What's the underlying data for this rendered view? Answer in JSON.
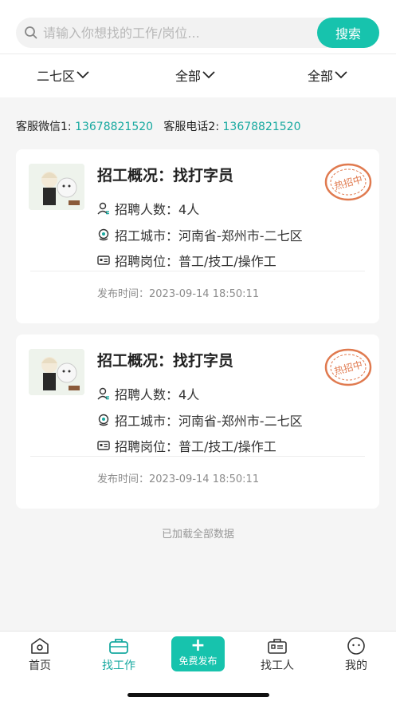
{
  "search": {
    "placeholder": "请输入你想找的工作/岗位...",
    "button_label": "搜索"
  },
  "filters": [
    {
      "label": "二七区"
    },
    {
      "label": "全部"
    },
    {
      "label": "全部"
    }
  ],
  "contact": {
    "wechat_label": "客服微信1:",
    "wechat_number": "13678821520",
    "phone_label": "客服电话2:",
    "phone_number": "13678821520"
  },
  "jobs": [
    {
      "title_prefix": "招工概况：",
      "title": "找打字员",
      "count_label": "招聘人数：",
      "count": "4人",
      "city_label": "招工城市：",
      "city": "河南省-郑州市-二七区",
      "position_label": "招聘岗位：",
      "position": "普工/技工/操作工",
      "time_label": "发布时间：",
      "time": "2023-09-14 18:50:11",
      "stamp": "热招中"
    },
    {
      "title_prefix": "招工概况：",
      "title": "找打字员",
      "count_label": "招聘人数：",
      "count": "4人",
      "city_label": "招工城市：",
      "city": "河南省-郑州市-二七区",
      "position_label": "招聘岗位：",
      "position": "普工/技工/操作工",
      "time_label": "发布时间：",
      "time": "2023-09-14 18:50:11",
      "stamp": "热招中"
    }
  ],
  "load_status": "已加载全部数据",
  "tabbar": {
    "home": "首页",
    "find_job": "找工作",
    "publish": "免费发布",
    "find_worker": "找工人",
    "mine": "我的"
  },
  "colors": {
    "accent": "#17c3ad",
    "link": "#17a9a0",
    "stamp": "#e07a4f"
  }
}
